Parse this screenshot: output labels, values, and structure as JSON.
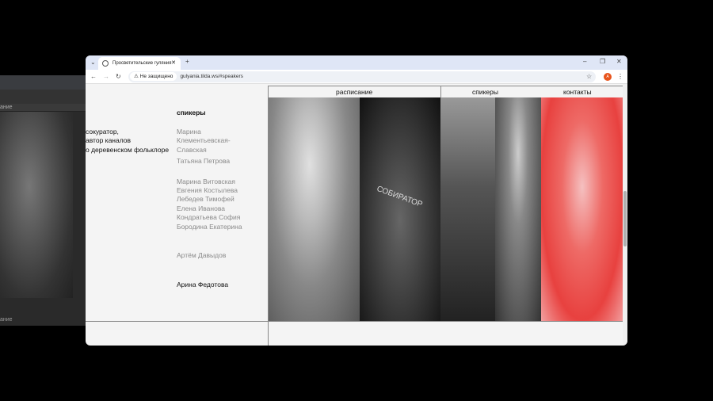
{
  "background_window": {
    "nav_fragment": "ание",
    "footer_fragment": "ание"
  },
  "browser": {
    "tab_title": "Просветительские гуляния",
    "security_label": "Не защищено",
    "url": "gulyania.tilda.ws/#speakers",
    "profile_initial": "A"
  },
  "page": {
    "nav": {
      "schedule": "расписание",
      "speakers": "спикеры",
      "contacts": "контакты"
    },
    "bio_lines": [
      "сокуратор,",
      "автор каналов",
      "о деревенском фольклоре"
    ],
    "speakers_heading": "спикеры",
    "speakers": [
      "Марина",
      "Клементьевская-",
      "Славская",
      "Татьяна Петрова",
      "Марина Витовская",
      "Евгения Костылева",
      "Лебедев Тимофей",
      "Елена Иванова",
      "Кондратьева София",
      "Бородина Екатерина",
      "Артём Давыдов",
      "Арина Федотова"
    ],
    "photo_captions": [
      "СОБИРАТОР"
    ]
  },
  "colors": {
    "accent_red": "#e8413f",
    "tab_bar": "#dfe6f6"
  }
}
